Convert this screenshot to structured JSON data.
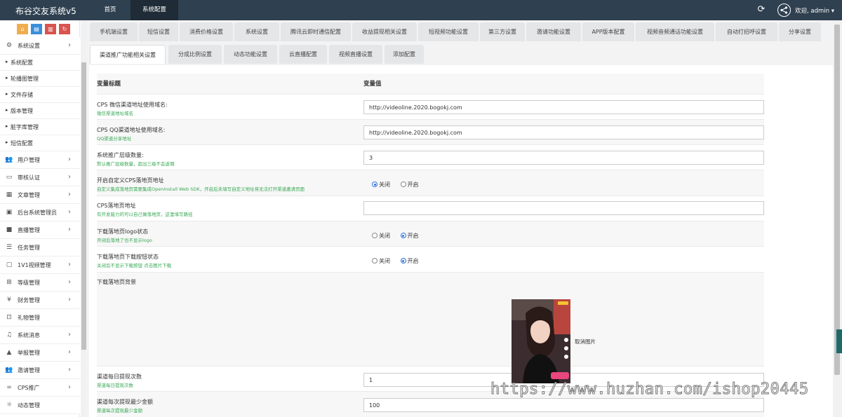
{
  "app": {
    "title": "布谷交友系统v5"
  },
  "topnav": {
    "items": [
      "首页",
      "系统配置"
    ]
  },
  "header": {
    "welcome": "欢迎, admin ▾"
  },
  "sidebar": {
    "menu_top": {
      "label": "系统设置"
    },
    "sub_items": [
      "系统配置",
      "轮播图管理",
      "文件存储",
      "版本管理",
      "脏字库管理",
      "短信配置"
    ],
    "items": [
      {
        "label": "用户管理",
        "icon": "users-icon"
      },
      {
        "label": "审核认证",
        "icon": "id-card-icon"
      },
      {
        "label": "文章管理",
        "icon": "grid-icon"
      },
      {
        "label": "后台系统管理员",
        "icon": "admin-card-icon"
      },
      {
        "label": "直播管理",
        "icon": "video-camera-icon"
      },
      {
        "label": "任务管理",
        "icon": "list-icon"
      },
      {
        "label": "1V1视频管理",
        "icon": "video-1v1-icon"
      },
      {
        "label": "等级管理",
        "icon": "sitemap-icon"
      },
      {
        "label": "财务管理",
        "icon": "yen-icon"
      },
      {
        "label": "礼物管理",
        "icon": "gift-icon"
      },
      {
        "label": "系统消息",
        "icon": "bell-icon"
      },
      {
        "label": "举报管理",
        "icon": "warning-icon"
      },
      {
        "label": "邀请管理",
        "icon": "users-group-icon"
      },
      {
        "label": "CPS推广",
        "icon": "handshake-icon"
      },
      {
        "label": "动态管理",
        "icon": "bulb-icon"
      }
    ]
  },
  "tabs_row1": [
    "手机端设置",
    "短信设置",
    "消费价格设置",
    "系统设置",
    "腾讯云即时通信配置",
    "收益提现相关设置",
    "短视频功能设置",
    "第三方设置",
    "邀请功能设置",
    "APP版本配置",
    "视频音频通话功能设置",
    "自动打招呼设置",
    "分享设置"
  ],
  "tabs_row2": [
    "渠道推广功能相关设置",
    "分成比例设置",
    "动态功能设置",
    "云直播配置",
    "视频直播设置",
    "添加配置"
  ],
  "table": {
    "col_title": "变量标题",
    "col_value": "变量值",
    "rows": [
      {
        "title": "CPS 微信渠道地址使用域名:",
        "hint": "微信渠道地址域名",
        "value": "http://videoline.2020.bogokj.com"
      },
      {
        "title": "CPS QQ渠道地址使用域名:",
        "hint": "QQ渠道分享地址",
        "value": "http://videoline.2020.bogokj.com"
      },
      {
        "title": "系统推广层级数量:",
        "hint": "默认推广层级数量，超出三级不会返佣",
        "value": "3"
      },
      {
        "title": "开启自定义CPS落地页地址",
        "hint": "自定义集成落地页需要集成OpenInstall Web SDK，开启后未填写自定义地址将无法打开渠道邀请页面",
        "opt_off": "关闭",
        "opt_on": "开启",
        "selected": "关闭"
      },
      {
        "title": "CPS落地页地址",
        "hint": "有开发能力的可以自己做落地页，这里填写路径",
        "value": ""
      },
      {
        "title": "下载落地页logo状态",
        "hint": "开闭后落地了也不显示logo",
        "opt_off": "关闭",
        "opt_on": "开启",
        "selected": "开启"
      },
      {
        "title": "下载落地页下载按钮状态",
        "hint": "关闭后不显示下载按钮 点击图片下载",
        "opt_off": "关闭",
        "opt_on": "开启",
        "selected": "开启"
      },
      {
        "title": "下载落地页背景",
        "remove_label": "取消图片"
      },
      {
        "title": "渠道每日提现次数",
        "hint": "渠道每日提现次数",
        "value": "1"
      },
      {
        "title": "渠道每次提现最少金额",
        "hint": "渠道每次提现最少金额",
        "value": "100"
      }
    ]
  },
  "watermark": "https://www.huzhan.com/ishop20445",
  "colors": {
    "topbar": "#2f4050",
    "hint": "#3aa856",
    "quick_orange": "#f0ad4e",
    "quick_blue": "#3d8ed8",
    "quick_red": "#d9534f"
  }
}
